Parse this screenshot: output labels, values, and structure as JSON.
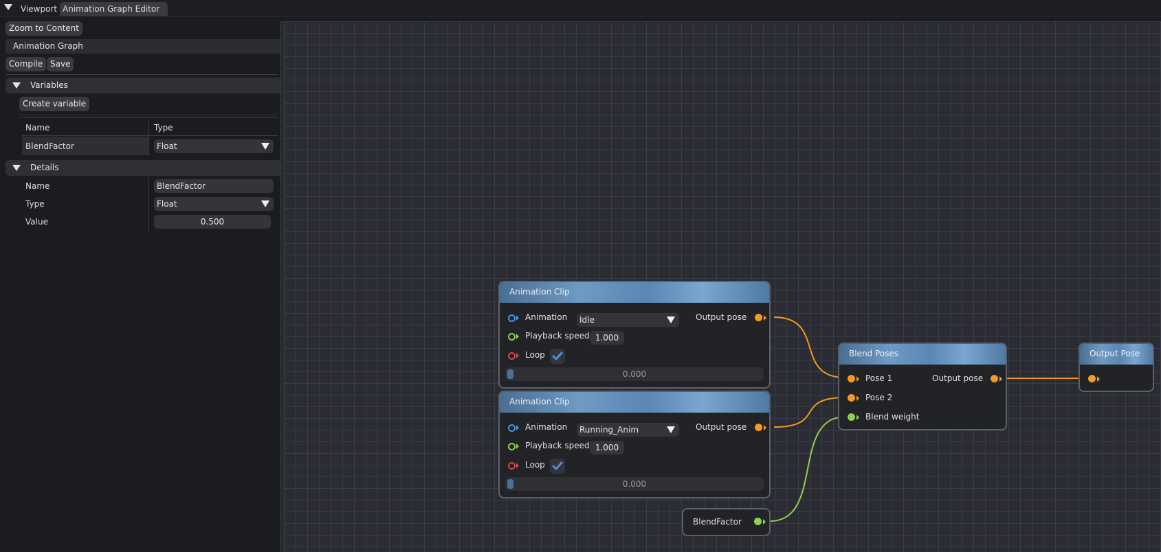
{
  "tabs": {
    "viewport": "Viewport",
    "editor": "Animation Graph Editor"
  },
  "toolbar": {
    "zoom_to_content": "Zoom to Content",
    "graph_name": "Animation Graph",
    "compile": "Compile",
    "save": "Save"
  },
  "variables": {
    "header": "Variables",
    "create_button": "Create variable",
    "columns": {
      "name": "Name",
      "type": "Type"
    },
    "rows": [
      {
        "name": "BlendFactor",
        "type": "Float"
      }
    ]
  },
  "details": {
    "header": "Details",
    "name_label": "Name",
    "name_value": "BlendFactor",
    "type_label": "Type",
    "type_value": "Float",
    "value_label": "Value",
    "value_value": "0.500"
  },
  "graph": {
    "clip1": {
      "title": "Animation Clip",
      "animation_label": "Animation",
      "animation_value": "Idle",
      "speed_label": "Playback speed",
      "speed_value": "1.000",
      "loop_label": "Loop",
      "output_label": "Output pose",
      "time_value": "0.000"
    },
    "clip2": {
      "title": "Animation Clip",
      "animation_label": "Animation",
      "animation_value": "Running_Anim",
      "speed_label": "Playback speed",
      "speed_value": "1.000",
      "loop_label": "Loop",
      "output_label": "Output pose",
      "time_value": "0.000"
    },
    "blend": {
      "title": "Blend Poses",
      "pose1": "Pose 1",
      "pose2": "Pose 2",
      "weight": "Blend weight",
      "output_label": "Output pose"
    },
    "output": {
      "title": "Output Pose"
    },
    "variable_node": {
      "label": "BlendFactor"
    }
  },
  "colors": {
    "pose_pin": "#f39a21",
    "float_pin": "#8fd14f",
    "animation_pin": "#3d9be9",
    "bool_pin": "#d94545",
    "check": "#4a90e2",
    "node_header": "#5a87b3"
  },
  "icons": {
    "collapse": "triangle-down-icon",
    "combo": "triangle-down-icon",
    "checkbox": "checkmark-icon"
  }
}
